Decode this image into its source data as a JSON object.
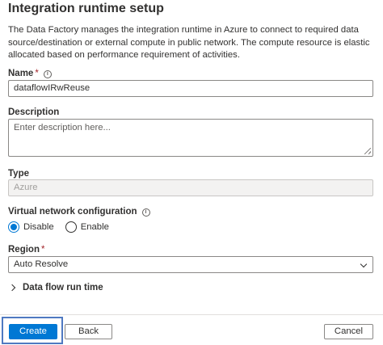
{
  "panel": {
    "title": "Integration runtime setup",
    "description": "The Data Factory manages the integration runtime in Azure to connect to required data source/destination or external compute in public network. The compute resource is elastic allocated based on performance requirement of activities."
  },
  "form": {
    "name": {
      "label": "Name",
      "required_mark": "*",
      "value": "dataflowIRwReuse"
    },
    "description": {
      "label": "Description",
      "placeholder": "Enter description here..."
    },
    "type": {
      "label": "Type",
      "value": "Azure"
    },
    "vnet": {
      "label": "Virtual network configuration",
      "options": [
        "Disable",
        "Enable"
      ],
      "selected": "Disable"
    },
    "region": {
      "label": "Region",
      "required_mark": "*",
      "value": "Auto Resolve"
    },
    "dataflow_runtime": {
      "label": "Data flow run time"
    }
  },
  "footer": {
    "create_label": "Create",
    "back_label": "Back",
    "cancel_label": "Cancel"
  },
  "colors": {
    "accent": "#0078d4",
    "required": "#a4262c",
    "focus": "#4f79c1"
  }
}
